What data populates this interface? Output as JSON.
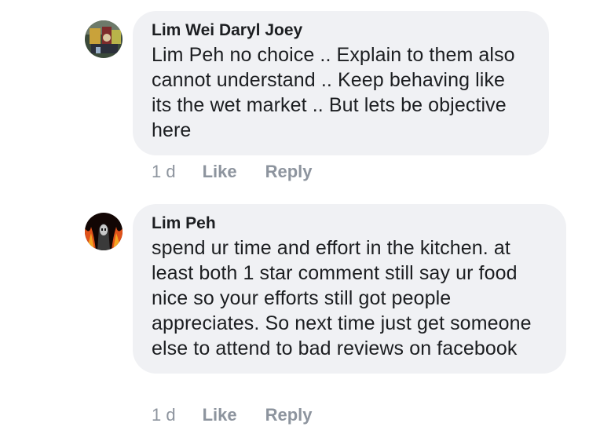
{
  "comments": [
    {
      "author": "Lim Wei Daryl Joey",
      "text": "Lim Peh no choice .. Explain to them also cannot understand .. Keep behaving like its the wet market .. But lets be objective here",
      "time": "1 d",
      "like_label": "Like",
      "reply_label": "Reply",
      "avatar_icon": "profile-photo-icon"
    },
    {
      "author": "Lim Peh",
      "text": "spend ur time and effort in the kitchen. at least both 1 star comment still say ur food nice so your efforts still got people appreciates. So next time just get someone else to attend to bad reviews on facebook",
      "time": "1 d",
      "like_label": "Like",
      "reply_label": "Reply",
      "avatar_icon": "profile-photo-icon"
    }
  ],
  "colors": {
    "bubble": "#f0f1f4",
    "text": "#1c1e21",
    "meta": "#8d949e"
  }
}
